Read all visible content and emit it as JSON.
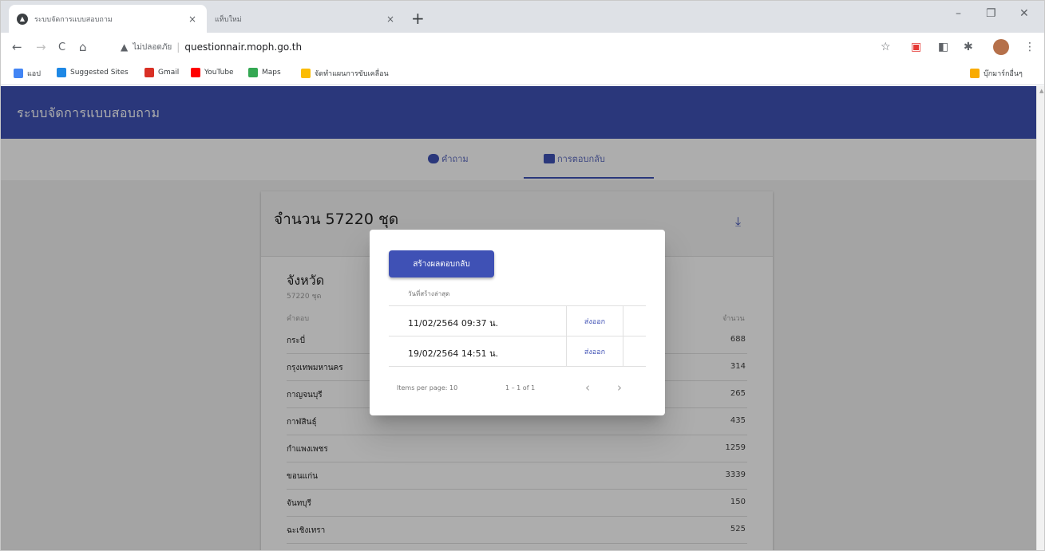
{
  "browser": {
    "tabs": [
      {
        "title": "ระบบจัดการแบบสอบถาม",
        "active": true
      },
      {
        "title": "แท็บใหม่",
        "active": false
      }
    ],
    "new_tab": "+",
    "close_glyph": "×",
    "window_controls": {
      "minimize": "–",
      "restore": "❐",
      "close": "✕"
    },
    "address": {
      "security_label": "ไม่ปลอดภัย",
      "url": "questionnair.moph.go.th"
    },
    "nav": {
      "back": "←",
      "forward": "→",
      "reload": "C",
      "home": "⌂"
    },
    "bookmarks": [
      {
        "label": "แอป",
        "color": "#4285f4"
      },
      {
        "label": "Suggested Sites",
        "color": "#1e88e5"
      },
      {
        "label": "Gmail",
        "color": "#d93025"
      },
      {
        "label": "YouTube",
        "color": "#ff0000"
      },
      {
        "label": "Maps",
        "color": "#34a853"
      },
      {
        "label": "จัดทำแผนการขับเคลื่อน",
        "color": "#fbbc04"
      }
    ],
    "other_bookmarks": "บุ๊กมาร์กอื่นๆ"
  },
  "app": {
    "title": "ระบบจัดการแบบสอบถาม",
    "nav_tabs": [
      {
        "label": "คำถาม",
        "active": false
      },
      {
        "label": "การตอบกลับ",
        "active": true
      }
    ],
    "summary": {
      "title": "จำนวน 57220 ชุด",
      "download_icon": "download-icon"
    },
    "province_section": {
      "title": "จังหวัด",
      "subtitle": "57220 ชุด",
      "col_name": "คำตอบ",
      "col_count": "จำนวน",
      "rows": [
        {
          "name": "กระบี่",
          "count": "688"
        },
        {
          "name": "กรุงเทพมหานคร",
          "count": "314"
        },
        {
          "name": "กาญจนบุรี",
          "count": "265"
        },
        {
          "name": "กาฬสินธุ์",
          "count": "435"
        },
        {
          "name": "กำแพงเพชร",
          "count": "1259"
        },
        {
          "name": "ขอนแก่น",
          "count": "3339"
        },
        {
          "name": "จันทบุรี",
          "count": "150"
        },
        {
          "name": "ฉะเชิงเทรา",
          "count": "525"
        }
      ]
    }
  },
  "dialog": {
    "create_button": "สร้างผลตอบกลับ",
    "table_header": "วันที่สร้างล่าสุด",
    "exports": [
      {
        "date": "11/02/2564 09:37 น.",
        "action": "ส่งออก"
      },
      {
        "date": "19/02/2564 14:51 น.",
        "action": "ส่งออก"
      }
    ],
    "paginator": {
      "items_per_page": "Items per page: 10",
      "range": "1 – 1 of 1",
      "prev": "‹",
      "next": "›"
    }
  }
}
